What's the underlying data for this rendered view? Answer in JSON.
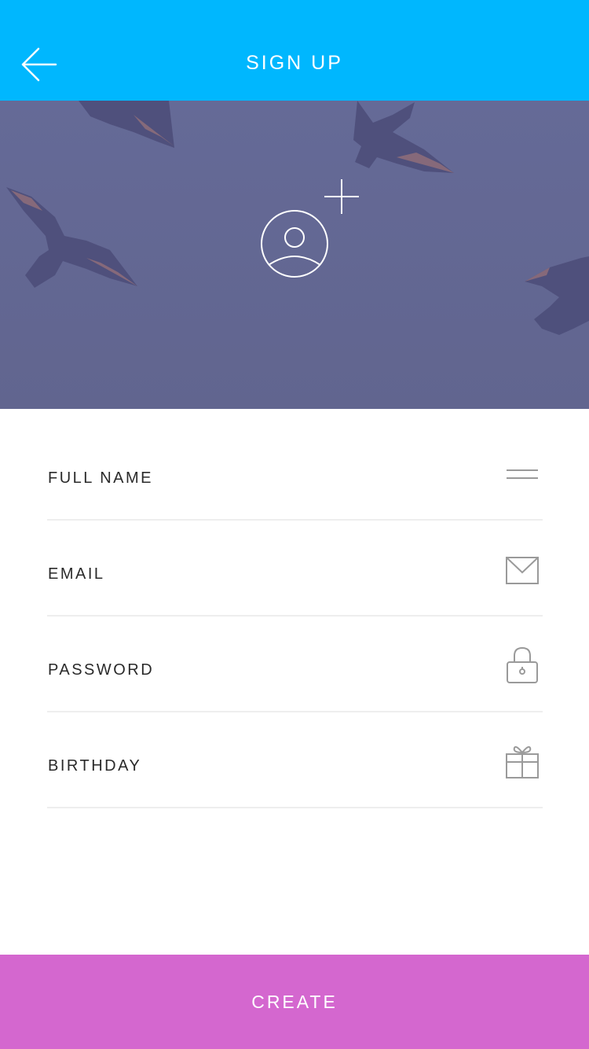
{
  "header": {
    "title": "SIGN UP",
    "back_icon": "arrow-left-icon",
    "background": "#00b7fe"
  },
  "hero": {
    "background": "#636894",
    "avatar_icon": "user-circle-icon",
    "add_icon": "plus-icon"
  },
  "form": {
    "fields": [
      {
        "label": "FULL NAME",
        "icon": "name-lines-icon"
      },
      {
        "label": "EMAIL",
        "icon": "envelope-icon"
      },
      {
        "label": "PASSWORD",
        "icon": "lock-icon"
      },
      {
        "label": "BIRTHDAY",
        "icon": "gift-icon"
      }
    ]
  },
  "footer": {
    "create_label": "CREATE",
    "background": "#d467cf"
  }
}
